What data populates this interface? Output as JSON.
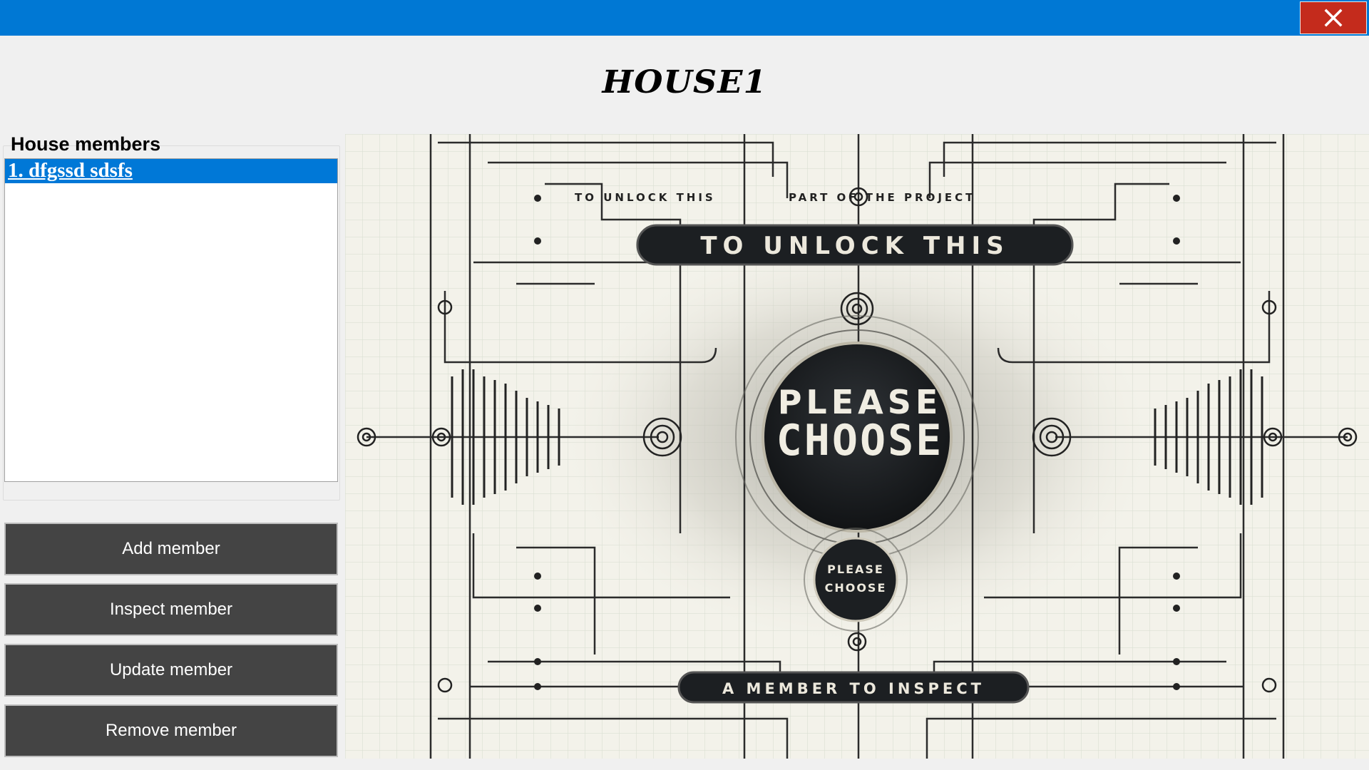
{
  "window": {
    "title": "HOUSE1",
    "close_icon": "close-icon",
    "titlebar_color": "#0078d4",
    "close_color": "#c42b1c"
  },
  "members_group": {
    "label": "House members",
    "items": [
      {
        "label": "1. dfgssd sdsfs ",
        "selected": true
      }
    ],
    "selection_color": "#0078d7"
  },
  "actions": {
    "add_label": "Add member",
    "inspect_label": "Inspect member",
    "update_label": "Update member",
    "remove_label": "Remove member",
    "button_color": "#444444"
  },
  "placeholder_image": {
    "top_line_left": "TO UNLOCK THIS",
    "top_line_right": "PART OF THE PROJECT",
    "banner_top": "TO UNLOCK THIS",
    "center_line1": "PLEASE",
    "center_line2": "CHOOSE",
    "small_line1": "PLEASE",
    "small_line2": "CHOOSE",
    "banner_bottom": "A MEMBER TO INSPECT"
  }
}
